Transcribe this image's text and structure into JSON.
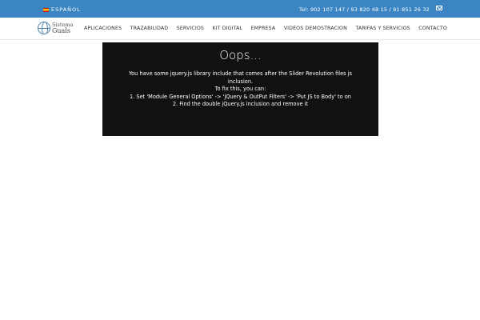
{
  "topbar": {
    "language": "ESPAÑOL",
    "phones": "Tel: 902 107 147 / 93 820 48 15 / 91 851 26 32",
    "icons": {
      "flag": "spain-flag-icon",
      "mail": "mail-icon"
    }
  },
  "header": {
    "logo": {
      "line1": "Sistema",
      "line2": "Guals"
    },
    "menu": [
      {
        "label": "APLICACIONES"
      },
      {
        "label": "TRAZABILIDAD"
      },
      {
        "label": "SERVICIOS"
      },
      {
        "label": "KIT DIGITAL"
      },
      {
        "label": "EMPRESA"
      },
      {
        "label": "VIDEOS DEMOSTRACION"
      },
      {
        "label": "TARIFAS Y SERVICIOS"
      },
      {
        "label": "CONTACTO"
      }
    ]
  },
  "slider_error": {
    "title": "Oops...",
    "lines": [
      "You have some jquery.js library include that comes after the Slider Revolution files js",
      "inclusion.",
      "To fix this, you can:",
      "1. Set 'Module General Options' -> 'jQuery & OutPut Filters' -> 'Put JS to Body' to on",
      "2. Find the double jQuery.js inclusion and remove it"
    ]
  },
  "colors": {
    "topbar": "#3b86c2",
    "slider_bg": "#111111",
    "text": "#333333"
  }
}
